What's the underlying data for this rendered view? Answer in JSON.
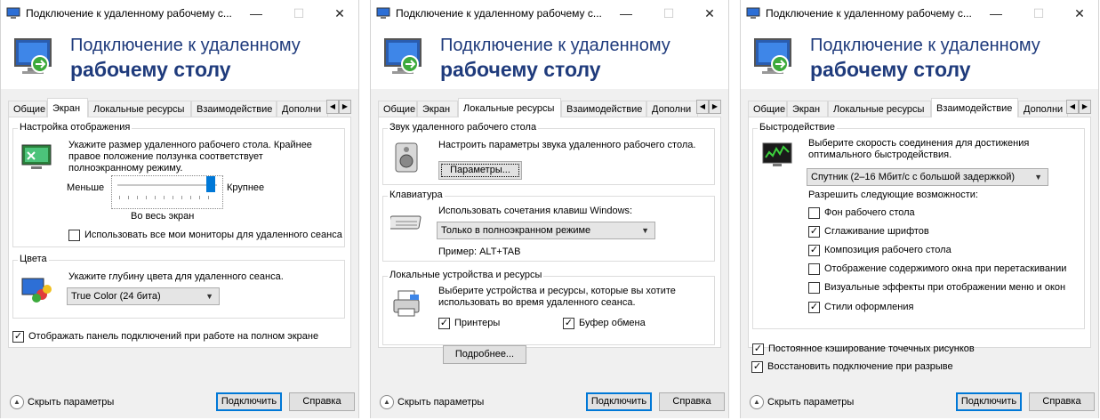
{
  "window_title": "Подключение к удаленному рабочему с...",
  "header": {
    "line1": "Подключение к удаленному",
    "line2": "рабочему столу"
  },
  "tabs": [
    "Общие",
    "Экран",
    "Локальные ресурсы",
    "Взаимодействие",
    "Дополни"
  ],
  "window_controls": {
    "minimize": "—",
    "maximize": "☐",
    "close": "✕"
  },
  "footer": {
    "hide_options": "Скрыть параметры",
    "connect": "Подключить",
    "help": "Справка"
  },
  "screen_tab": {
    "display_group": "Настройка отображения",
    "display_text": "Укажите размер удаленного рабочего стола. Крайнее правое положение ползунка соответствует полноэкранному режиму.",
    "smaller": "Меньше",
    "larger": "Крупнее",
    "fullscreen": "Во весь экран",
    "slider_value": 1.0,
    "all_monitors": "Использовать все мои мониторы для удаленного сеанса",
    "all_monitors_checked": false,
    "colors_group": "Цвета",
    "colors_text": "Укажите глубину цвета для удаленного сеанса.",
    "color_depth": "True Color (24 бита)",
    "show_bar": "Отображать панель подключений при работе на полном экране",
    "show_bar_checked": true
  },
  "local_tab": {
    "sound_group": "Звук удаленного рабочего стола",
    "sound_text": "Настроить параметры звука удаленного рабочего стола.",
    "params_button": "Параметры...",
    "keyboard_group": "Клавиатура",
    "keyboard_text": "Использовать сочетания клавиш Windows:",
    "keyboard_mode": "Только в полноэкранном режиме",
    "example": "Пример: ALT+TAB",
    "devices_group": "Локальные устройства и ресурсы",
    "devices_text": "Выберите устройства и ресурсы, которые вы хотите использовать во время удаленного сеанса.",
    "printers": "Принтеры",
    "printers_checked": true,
    "clipboard": "Буфер обмена",
    "clipboard_checked": true,
    "more_button": "Подробнее..."
  },
  "experience_tab": {
    "perf_group": "Быстродействие",
    "perf_text": "Выберите скорость соединения для достижения оптимального быстродействия.",
    "speed": "Спутник (2–16 Мбит/с с большой задержкой)",
    "allow_text": "Разрешить следующие возможности:",
    "options": [
      {
        "label": "Фон рабочего стола",
        "checked": false
      },
      {
        "label": "Сглаживание шрифтов",
        "checked": true
      },
      {
        "label": "Композиция рабочего стола",
        "checked": true
      },
      {
        "label": "Отображение содержимого окна при перетаскивании",
        "checked": false
      },
      {
        "label": "Визуальные эффекты при отображении меню и окон",
        "checked": false
      },
      {
        "label": "Стили оформления",
        "checked": true
      }
    ],
    "bitmap_cache": "Постоянное кэширование точечных рисунков",
    "bitmap_cache_checked": true,
    "reconnect": "Восстановить подключение при разрыве",
    "reconnect_checked": true
  }
}
